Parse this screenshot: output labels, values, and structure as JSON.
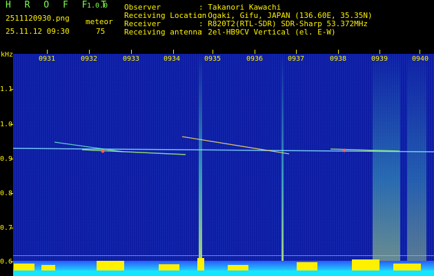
{
  "header": {
    "logo": "H R O F F T",
    "version": "1.0.0",
    "filename": "2511120930.png",
    "datetime": "25.11.12 09:30",
    "meteor_label": "meteor",
    "meteor_count": "75",
    "info": [
      {
        "label": "Observer",
        "value": ": Takanori Kawachi"
      },
      {
        "label": "Receiving Location",
        "value": ": Ogaki, Gifu, JAPAN (136.60E, 35.35N)"
      },
      {
        "label": "Receiver",
        "value": ": R820T2(RTL-SDR) SDR-Sharp 53.372MHz"
      },
      {
        "label": "Receiving antenna",
        "value": ": 2el-HB9CV Vertical (el. E-W)"
      }
    ]
  },
  "axis": {
    "unit": "kHz",
    "time_labels": [
      "0931",
      "0932",
      "0933",
      "0934",
      "0935",
      "0936",
      "0937",
      "0938",
      "0939",
      "0940"
    ],
    "freq_labels": [
      "1.1",
      "1.0",
      "0.9",
      "0.8",
      "0.7",
      "0.6"
    ]
  },
  "colors": {
    "text": "#fff200",
    "logo": "#7dff4a",
    "background": "#0c1aa0"
  }
}
